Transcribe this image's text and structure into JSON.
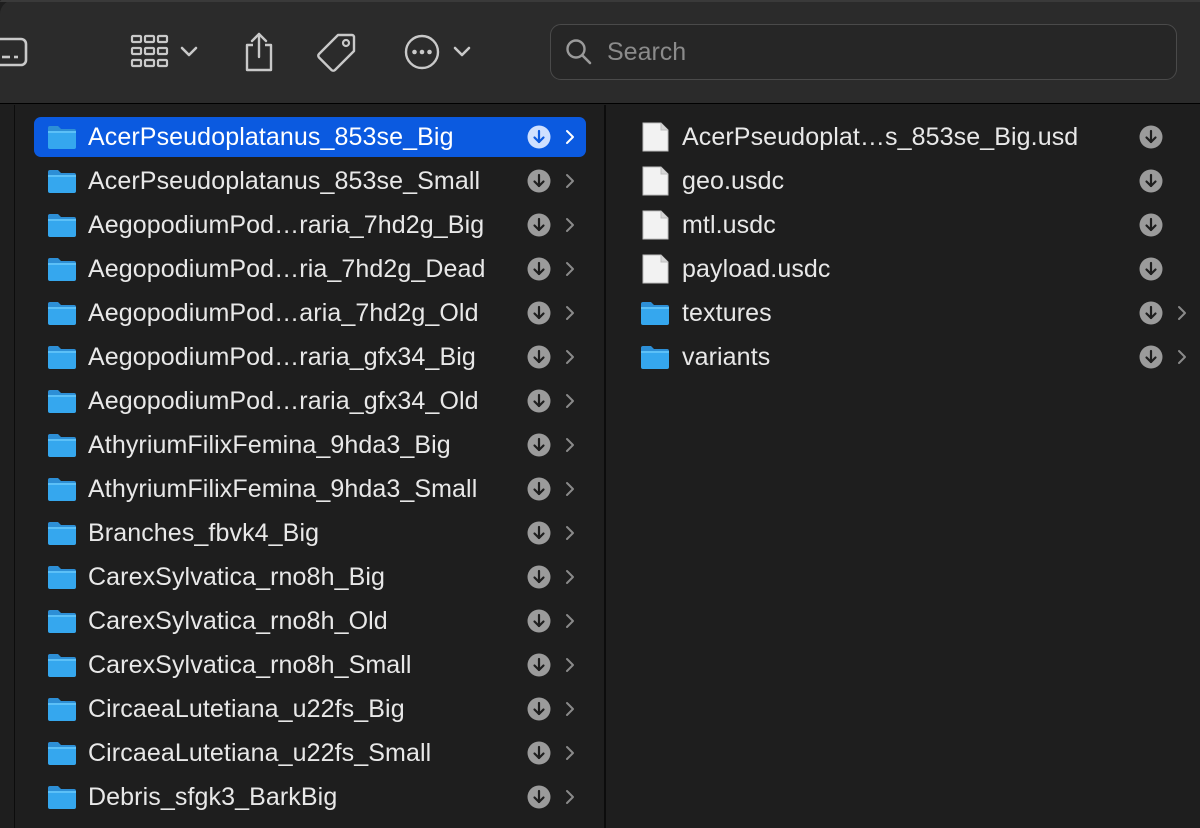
{
  "toolbar": {
    "search": {
      "placeholder": "Search"
    },
    "icons": [
      "sidebar-toggle-icon",
      "view-grid-icon",
      "chevron-down-icon",
      "share-icon",
      "tag-icon",
      "more-icon",
      "chevron-down-icon"
    ]
  },
  "colors": {
    "selection": "#0b5ae0",
    "folder": "#35a7ee",
    "background": "#1e1e1e",
    "toolbar": "#2b2b2b"
  },
  "column1": {
    "items": [
      {
        "name": "AcerPseudoplatanus_853se_Big",
        "type": "folder",
        "selected": true
      },
      {
        "name": "AcerPseudoplatanus_853se_Small",
        "type": "folder"
      },
      {
        "name": "AegopodiumPod…raria_7hd2g_Big",
        "type": "folder"
      },
      {
        "name": "AegopodiumPod…ria_7hd2g_Dead",
        "type": "folder"
      },
      {
        "name": "AegopodiumPod…aria_7hd2g_Old",
        "type": "folder"
      },
      {
        "name": "AegopodiumPod…raria_gfx34_Big",
        "type": "folder"
      },
      {
        "name": "AegopodiumPod…raria_gfx34_Old",
        "type": "folder"
      },
      {
        "name": "AthyriumFilixFemina_9hda3_Big",
        "type": "folder"
      },
      {
        "name": "AthyriumFilixFemina_9hda3_Small",
        "type": "folder"
      },
      {
        "name": "Branches_fbvk4_Big",
        "type": "folder"
      },
      {
        "name": "CarexSylvatica_rno8h_Big",
        "type": "folder"
      },
      {
        "name": "CarexSylvatica_rno8h_Old",
        "type": "folder"
      },
      {
        "name": "CarexSylvatica_rno8h_Small",
        "type": "folder"
      },
      {
        "name": "CircaeaLutetiana_u22fs_Big",
        "type": "folder"
      },
      {
        "name": "CircaeaLutetiana_u22fs_Small",
        "type": "folder"
      },
      {
        "name": "Debris_sfgk3_BarkBig",
        "type": "folder"
      }
    ]
  },
  "column2": {
    "items": [
      {
        "name": "AcerPseudoplat…s_853se_Big.usd",
        "type": "file"
      },
      {
        "name": "geo.usdc",
        "type": "file"
      },
      {
        "name": "mtl.usdc",
        "type": "file"
      },
      {
        "name": "payload.usdc",
        "type": "file"
      },
      {
        "name": "textures",
        "type": "folder"
      },
      {
        "name": "variants",
        "type": "folder"
      }
    ]
  }
}
